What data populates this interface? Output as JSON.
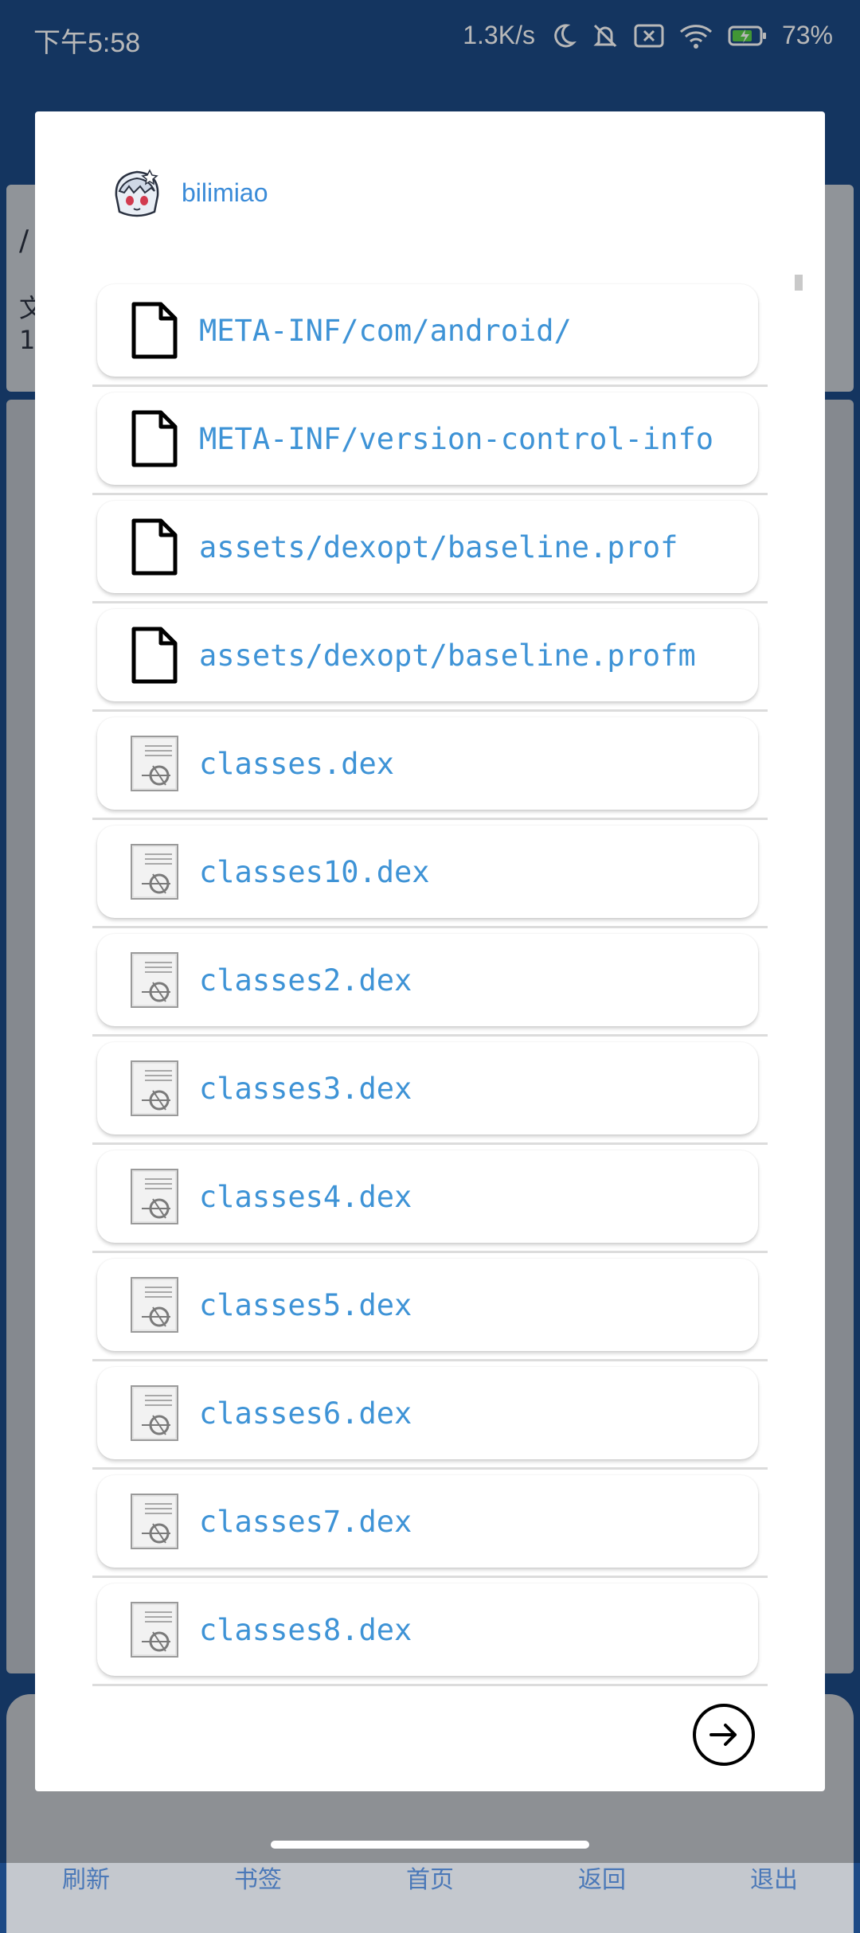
{
  "status_bar": {
    "time": "下午5:58",
    "net_speed": "1.3K/s",
    "battery": "73%"
  },
  "background": {
    "path_prefix": "/",
    "info_1": "文",
    "info_2": "1",
    "nav": [
      "刷新",
      "书签",
      "首页",
      "返回",
      "退出"
    ]
  },
  "dialog": {
    "app_name": "bilimiao",
    "entries": [
      {
        "name": "META-INF/com/android/",
        "icon": "file-icon"
      },
      {
        "name": "META-INF/version-control-info",
        "icon": "file-icon"
      },
      {
        "name": "assets/dexopt/baseline.prof",
        "icon": "file-icon"
      },
      {
        "name": "assets/dexopt/baseline.profm",
        "icon": "file-icon"
      },
      {
        "name": "classes.dex",
        "icon": "dex-icon"
      },
      {
        "name": "classes10.dex",
        "icon": "dex-icon"
      },
      {
        "name": "classes2.dex",
        "icon": "dex-icon"
      },
      {
        "name": "classes3.dex",
        "icon": "dex-icon"
      },
      {
        "name": "classes4.dex",
        "icon": "dex-icon"
      },
      {
        "name": "classes5.dex",
        "icon": "dex-icon"
      },
      {
        "name": "classes6.dex",
        "icon": "dex-icon"
      },
      {
        "name": "classes7.dex",
        "icon": "dex-icon"
      },
      {
        "name": "classes8.dex",
        "icon": "dex-icon"
      }
    ],
    "action_icon": "arrow-right-circle-icon"
  }
}
